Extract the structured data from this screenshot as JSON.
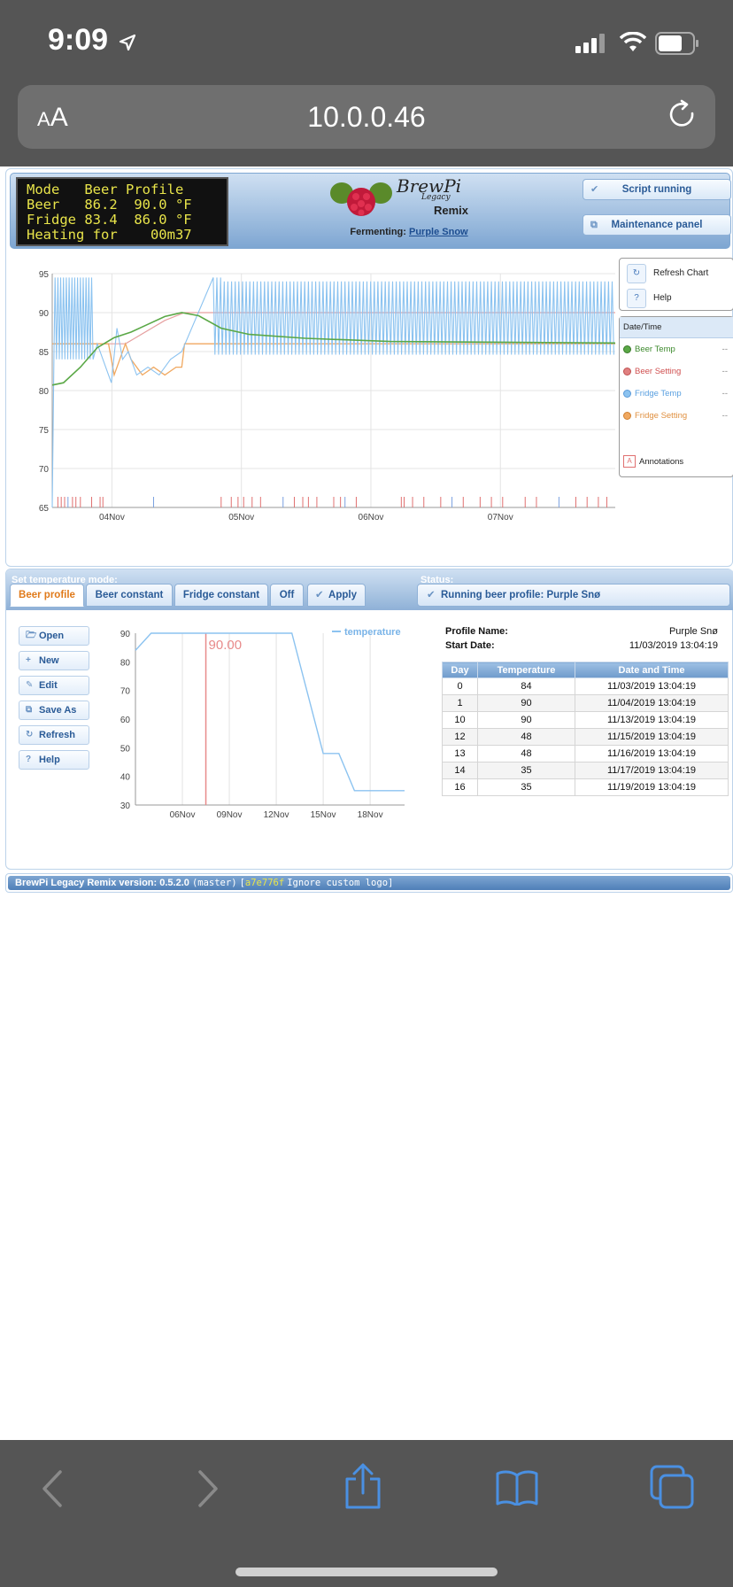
{
  "status_bar": {
    "time": "9:09"
  },
  "url_bar": {
    "aa_small": "A",
    "aa_large": "A",
    "url": "10.0.0.46"
  },
  "header": {
    "lcd_lines": [
      "Mode   Beer Profile",
      "Beer   86.2  90.0 °F",
      "Fridge 83.4  86.0 °F",
      "Heating for    00m37"
    ],
    "logo_text": "BrewPi",
    "logo_sub": "Legacy",
    "logo_remix": "Remix",
    "fermenting_label": "Fermenting:",
    "fermenting_name": "Purple Snow",
    "script_button": "Script running",
    "maintenance_button": "Maintenance panel"
  },
  "chart_side": {
    "refresh_label": "Refresh Chart",
    "help_label": "Help",
    "legend_header": "Date/Time",
    "legend": [
      {
        "name": "Beer Temp",
        "color": "#4a9a3a",
        "value": "--"
      },
      {
        "name": "Beer Setting",
        "color": "#e06060",
        "value": "--"
      },
      {
        "name": "Fridge Temp",
        "color": "#6aaee8",
        "value": "--"
      },
      {
        "name": "Fridge Setting",
        "color": "#f0a050",
        "value": "--"
      }
    ],
    "annotations_label": "Annotations",
    "annotations_icon": "A"
  },
  "chart_data": [
    {
      "type": "line",
      "ylim": [
        65,
        95
      ],
      "yticks": [
        "95",
        "90",
        "85",
        "80",
        "75",
        "70",
        "65"
      ],
      "xticks": [
        "04Nov",
        "05Nov",
        "06Nov",
        "07Nov"
      ],
      "grid": true,
      "legend": "right",
      "series": [
        {
          "name": "Beer Temp",
          "color": "#5aa846"
        },
        {
          "name": "Beer Setting",
          "color": "#e08080"
        },
        {
          "name": "Fridge Temp",
          "color": "#8cc3f0"
        },
        {
          "name": "Fridge Setting",
          "color": "#f0a860"
        }
      ]
    },
    {
      "type": "line",
      "ylim": [
        30,
        90
      ],
      "yticks": [
        "90",
        "80",
        "70",
        "60",
        "50",
        "40",
        "30"
      ],
      "xticks": [
        "06Nov",
        "09Nov",
        "12Nov",
        "15Nov",
        "18Nov"
      ],
      "grid": true,
      "legend": "top-right",
      "series": [
        {
          "name": "temperature",
          "color": "#8cc3f0"
        }
      ],
      "current_value_label": "90.00"
    }
  ],
  "controls": {
    "mode_label": "Set temperature mode:",
    "status_label": "Status:",
    "tabs": [
      "Beer profile",
      "Beer constant",
      "Fridge constant",
      "Off"
    ],
    "apply_label": "Apply",
    "status_text": "Running beer profile: Purple Snø",
    "profile_buttons": [
      "Open",
      "New",
      "Edit",
      "Save As",
      "Refresh",
      "Help"
    ],
    "profile_name_label": "Profile Name:",
    "profile_name": "Purple Snø",
    "start_date_label": "Start Date:",
    "start_date": "11/03/2019 13:04:19",
    "table_headers": [
      "Day",
      "Temperature",
      "Date and Time"
    ],
    "table_rows": [
      [
        "0",
        "84",
        "11/03/2019 13:04:19"
      ],
      [
        "1",
        "90",
        "11/04/2019 13:04:19"
      ],
      [
        "10",
        "90",
        "11/13/2019 13:04:19"
      ],
      [
        "12",
        "48",
        "11/15/2019 13:04:19"
      ],
      [
        "13",
        "48",
        "11/16/2019 13:04:19"
      ],
      [
        "14",
        "35",
        "11/17/2019 13:04:19"
      ],
      [
        "16",
        "35",
        "11/19/2019 13:04:19"
      ]
    ]
  },
  "footer": {
    "version_text": "BrewPi Legacy Remix version: 0.5.2.0",
    "branch": "(master)",
    "bracket_open": "[",
    "hash": "a7e776f",
    "commit_msg": "Ignore custom logo",
    "bracket_close": "]"
  }
}
